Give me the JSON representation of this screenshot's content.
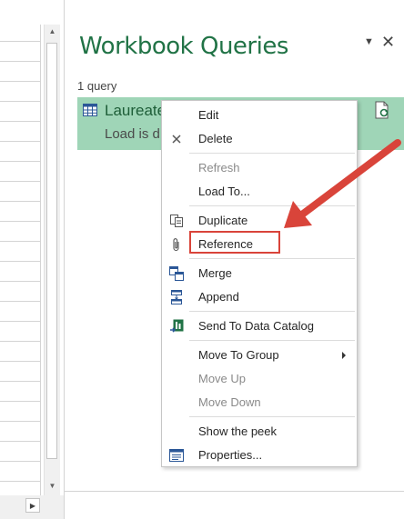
{
  "pane": {
    "title": "Workbook Queries",
    "query_count": "1 query",
    "query": {
      "name": "Laureate",
      "status": "Load is d"
    }
  },
  "context_menu": {
    "items": [
      {
        "label": "Edit",
        "icon": "",
        "disabled": false
      },
      {
        "label": "Delete",
        "icon": "close-icon",
        "disabled": false
      },
      {
        "label": "Refresh",
        "icon": "",
        "disabled": true
      },
      {
        "label": "Load To...",
        "icon": "",
        "disabled": false
      },
      {
        "label": "Duplicate",
        "icon": "duplicate-icon",
        "disabled": false
      },
      {
        "label": "Reference",
        "icon": "paperclip-icon",
        "disabled": false
      },
      {
        "label": "Merge",
        "icon": "merge-icon",
        "disabled": false
      },
      {
        "label": "Append",
        "icon": "append-icon",
        "disabled": false
      },
      {
        "label": "Send To Data Catalog",
        "icon": "data-catalog-icon",
        "disabled": false
      },
      {
        "label": "Move To Group",
        "icon": "",
        "disabled": false
      },
      {
        "label": "Move Up",
        "icon": "",
        "disabled": true
      },
      {
        "label": "Move Down",
        "icon": "",
        "disabled": true
      },
      {
        "label": "Show the peek",
        "icon": "",
        "disabled": false
      },
      {
        "label": "Properties...",
        "icon": "properties-icon",
        "disabled": false
      }
    ]
  },
  "colors": {
    "accent": "#217346",
    "query_card_bg": "#9fd5b7",
    "annotation_red": "#d9443a"
  }
}
